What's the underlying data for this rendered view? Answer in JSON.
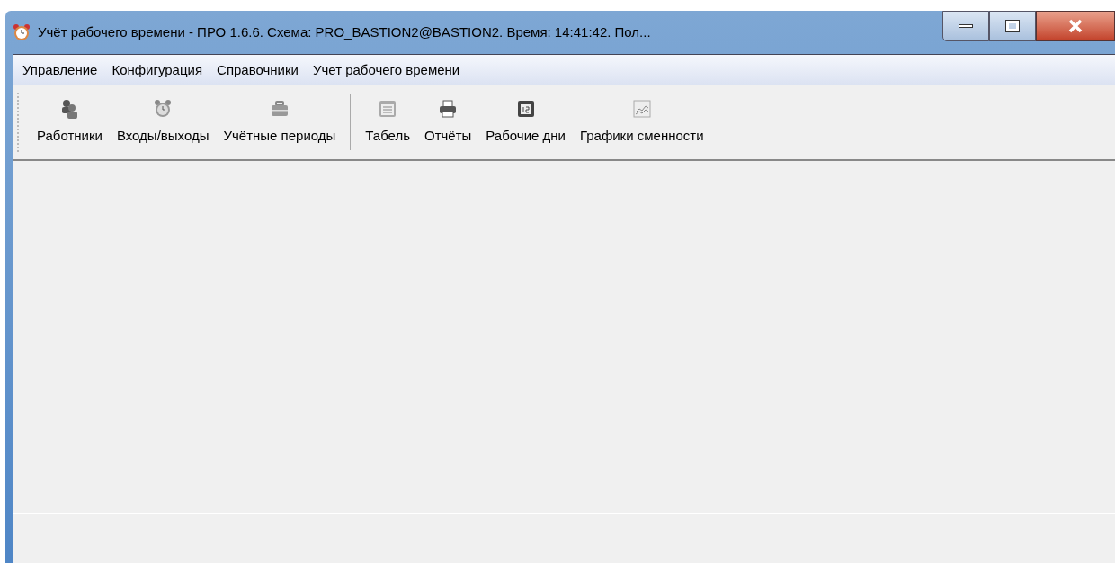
{
  "window": {
    "title": "Учёт рабочего времени - ПРО 1.6.6. Схема: PRO_BASTION2@BASTION2. Время: 14:41:42. Пол..."
  },
  "menu": [
    "Управление",
    "Конфигурация",
    "Справочники",
    "Учет рабочего времени"
  ],
  "toolbar": {
    "groups": [
      [
        {
          "label": "Работники"
        },
        {
          "label": "Входы/выходы"
        },
        {
          "label": "Учётные периоды"
        }
      ],
      [
        {
          "label": "Табель"
        },
        {
          "label": "Отчёты"
        },
        {
          "label": "Рабочие дни"
        },
        {
          "label": "Графики сменности"
        }
      ]
    ]
  }
}
